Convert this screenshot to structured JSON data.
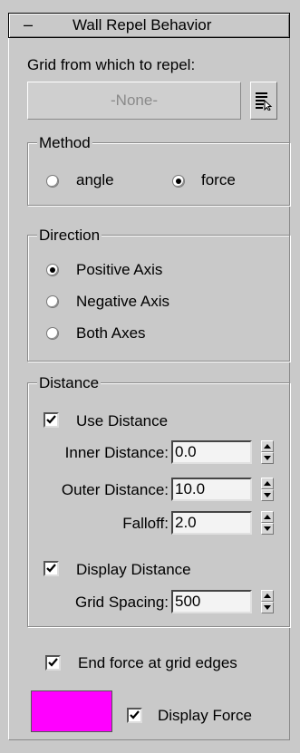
{
  "rollout": {
    "collapse": "–",
    "title": "Wall Repel Behavior"
  },
  "grid": {
    "label": "Grid from which to repel:",
    "none_button": "-None-",
    "pick_icon": "pick-list-icon"
  },
  "method": {
    "title": "Method",
    "options": [
      {
        "label": "angle",
        "selected": false
      },
      {
        "label": "force",
        "selected": true
      }
    ]
  },
  "direction": {
    "title": "Direction",
    "options": [
      {
        "label": "Positive Axis",
        "selected": true
      },
      {
        "label": "Negative Axis",
        "selected": false
      },
      {
        "label": "Both Axes",
        "selected": false
      }
    ]
  },
  "distance": {
    "title": "Distance",
    "use_distance": {
      "label": "Use Distance",
      "checked": true
    },
    "inner": {
      "label": "Inner Distance:",
      "value": "0.0"
    },
    "outer": {
      "label": "Outer Distance:",
      "value": "10.0"
    },
    "falloff": {
      "label": "Falloff:",
      "value": "2.0"
    },
    "display_distance": {
      "label": "Display Distance",
      "checked": true
    },
    "grid_spacing": {
      "label": "Grid Spacing:",
      "value": "500"
    }
  },
  "end_force": {
    "label": "End force at grid edges",
    "checked": true
  },
  "display_force": {
    "label": "Display Force",
    "checked": true,
    "color": "#ff00ff"
  }
}
